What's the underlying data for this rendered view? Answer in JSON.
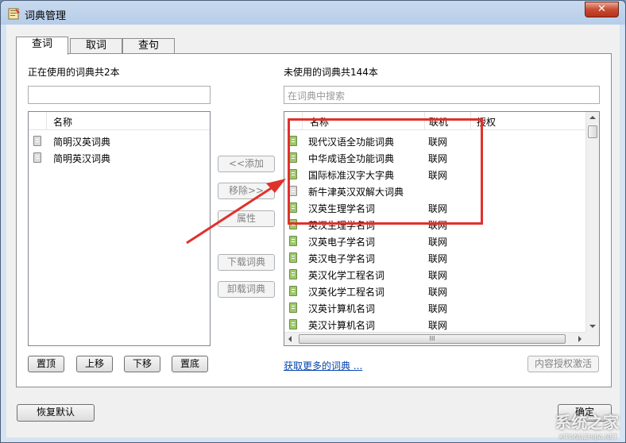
{
  "window": {
    "title": "词典管理",
    "close_glyph": "✕"
  },
  "tabs": [
    {
      "label": "查词",
      "active": true
    },
    {
      "label": "取词",
      "active": false
    },
    {
      "label": "查句",
      "active": false
    }
  ],
  "left": {
    "heading": "正在使用的词典共2本",
    "search_value": "",
    "column_name": "名称",
    "items": [
      "简明汉英词典",
      "简明英汉词典"
    ],
    "buttons": {
      "top": "置顶",
      "up": "上移",
      "down": "下移",
      "bottom": "置底"
    }
  },
  "middle": {
    "add": "<<添加",
    "remove": "移除>>",
    "properties": "属性",
    "download": "下载词典",
    "uninstall": "卸载词典"
  },
  "right": {
    "heading": "未使用的词典共144本",
    "search_placeholder": "在词典中搜索",
    "columns": {
      "name": "名称",
      "online": "联机",
      "auth": "授权"
    },
    "rows": [
      {
        "name": "现代汉语全功能词典",
        "online": "联网",
        "icon": "green"
      },
      {
        "name": "中华成语全功能词典",
        "online": "联网",
        "icon": "green"
      },
      {
        "name": "国际标准汉字大字典",
        "online": "联网",
        "icon": "green"
      },
      {
        "name": "新牛津英汉双解大词典",
        "online": "",
        "icon": "gray"
      },
      {
        "name": "汉英生理学名词",
        "online": "联网",
        "icon": "green"
      },
      {
        "name": "英汉生理学名词",
        "online": "联网",
        "icon": "green"
      },
      {
        "name": "汉英电子学名词",
        "online": "联网",
        "icon": "green"
      },
      {
        "name": "英汉电子学名词",
        "online": "联网",
        "icon": "green"
      },
      {
        "name": "英汉化学工程名词",
        "online": "联网",
        "icon": "green"
      },
      {
        "name": "汉英化学工程名词",
        "online": "联网",
        "icon": "green"
      },
      {
        "name": "汉英计算机名词",
        "online": "联网",
        "icon": "green"
      },
      {
        "name": "英汉计算机名词",
        "online": "联网",
        "icon": "green"
      }
    ],
    "more_link": "获取更多的词典 ...",
    "activate_button": "内容授权激活",
    "hscroll_thumb": "III"
  },
  "footer": {
    "restore_default": "恢复默认",
    "ok_button": "确定"
  },
  "watermark": {
    "text": "系统之家",
    "sub": "XITONGZHIJIA.NET"
  },
  "colors": {
    "annotation_red": "#e0312c",
    "link": "#0645ad"
  }
}
